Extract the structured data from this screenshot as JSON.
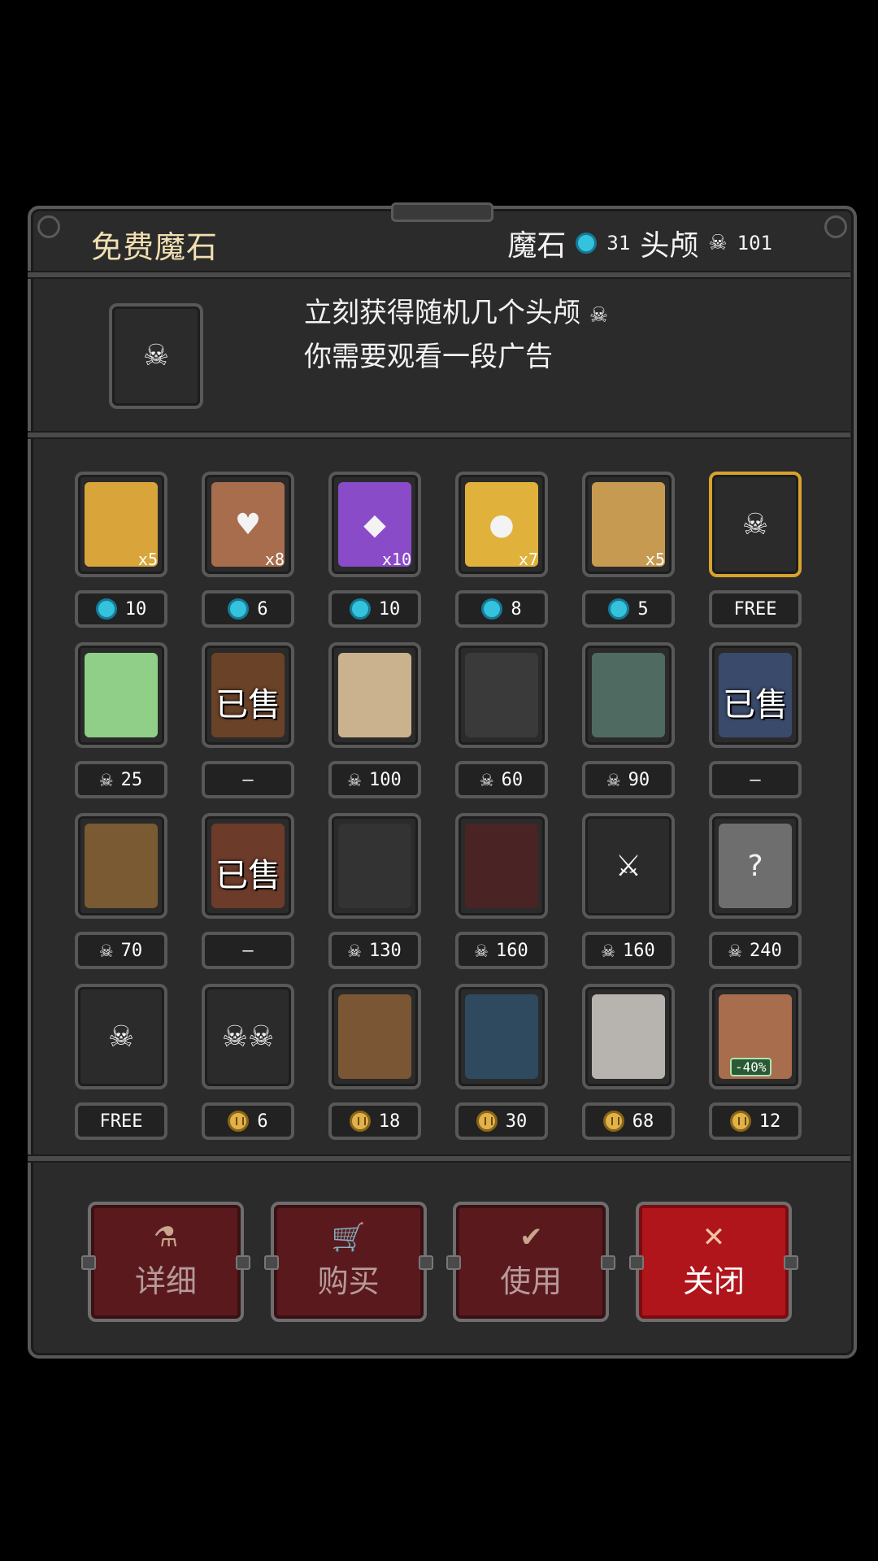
{
  "header": {
    "title": "免费魔石",
    "magic_stone_label": "魔石",
    "magic_stone_count": "31",
    "skull_label": "头颅",
    "skull_count": "101"
  },
  "info": {
    "line1": "立刻获得随机几个头颅",
    "line2": "你需要观看一段广告"
  },
  "colors": {
    "gem": "#34c2dd",
    "coin": "#e2b24a",
    "highlight_border": "#d8a32c",
    "close_button": "#b0151c"
  },
  "items": [
    {
      "icon": "gold-bars-icon",
      "qty": "x5",
      "price": "10",
      "currency": "gem"
    },
    {
      "icon": "heart-scroll-icon",
      "qty": "x8",
      "price": "6",
      "currency": "gem"
    },
    {
      "icon": "purple-crystal-icon",
      "qty": "x10",
      "price": "10",
      "currency": "gem"
    },
    {
      "icon": "golden-apple-icon",
      "qty": "x7",
      "price": "8",
      "currency": "gem"
    },
    {
      "icon": "skull-amulet-icon",
      "qty": "x5",
      "price": "5",
      "currency": "gem"
    },
    {
      "icon": "skull-icon",
      "qty": "",
      "price": "FREE",
      "currency": "none",
      "highlight": true
    },
    {
      "icon": "green-slime-icon",
      "qty": "",
      "price": "25",
      "currency": "skull"
    },
    {
      "icon": "tree-monster-icon",
      "qty": "",
      "price": "—",
      "currency": "none",
      "sold": "已售"
    },
    {
      "icon": "skeleton-warrior-icon",
      "qty": "",
      "price": "100",
      "currency": "skull"
    },
    {
      "icon": "hooded-reaper-icon",
      "qty": "",
      "price": "60",
      "currency": "skull"
    },
    {
      "icon": "zombie-shield-icon",
      "qty": "",
      "price": "90",
      "currency": "skull"
    },
    {
      "icon": "witch-icon",
      "qty": "",
      "price": "—",
      "currency": "none",
      "sold": "已售"
    },
    {
      "icon": "forest-goblin-icon",
      "qty": "",
      "price": "70",
      "currency": "skull"
    },
    {
      "icon": "vampire-girl-icon",
      "qty": "",
      "price": "—",
      "currency": "none",
      "sold": "已售"
    },
    {
      "icon": "dark-cultist-icon",
      "qty": "",
      "price": "130",
      "currency": "skull"
    },
    {
      "icon": "pirate-lich-icon",
      "qty": "",
      "price": "160",
      "currency": "skull"
    },
    {
      "icon": "crossed-swords-icon",
      "qty": "",
      "price": "160",
      "currency": "skull"
    },
    {
      "icon": "mystery-box-icon",
      "qty": "",
      "price": "240",
      "currency": "skull"
    },
    {
      "icon": "skull-to-gem-icon",
      "qty": "",
      "price": "FREE",
      "currency": "none"
    },
    {
      "icon": "skull-pile-icon",
      "qty": "",
      "price": "6",
      "currency": "coin"
    },
    {
      "icon": "wooden-chest-icon",
      "qty": "",
      "price": "18",
      "currency": "coin"
    },
    {
      "icon": "blue-chest-icon",
      "qty": "",
      "price": "30",
      "currency": "coin"
    },
    {
      "icon": "silver-chest-icon",
      "qty": "",
      "price": "68",
      "currency": "coin"
    },
    {
      "icon": "discount-scroll-icon",
      "qty": "",
      "price": "12",
      "currency": "coin",
      "discount": "-40%"
    }
  ],
  "buttons": {
    "details": "详细",
    "buy": "购买",
    "use": "使用",
    "close": "关闭"
  }
}
